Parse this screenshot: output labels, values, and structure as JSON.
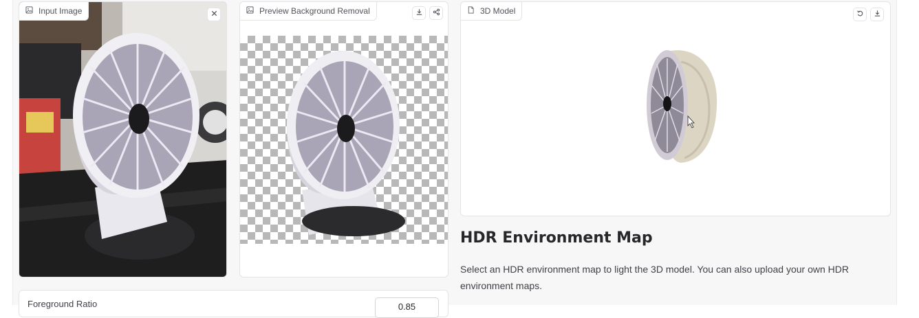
{
  "input_panel": {
    "label": "Input Image",
    "label_icon": "image-icon",
    "clear_icon": "close-icon"
  },
  "preview_panel": {
    "label": "Preview Background Removal",
    "label_icon": "image-icon",
    "actions": [
      "download-icon",
      "share-icon"
    ]
  },
  "model_panel": {
    "label": "3D Model",
    "label_icon": "file-icon",
    "actions": [
      "undo-icon",
      "download-icon"
    ]
  },
  "hdr_section": {
    "title": "HDR Environment Map",
    "description": "Select an HDR environment map to light the 3D model. You can also upload your own HDR environment maps."
  },
  "foreground_ratio": {
    "label": "Foreground Ratio",
    "value": "0.85"
  },
  "colors": {
    "background": "#f7f7f8",
    "panel_border": "#e4e4e7",
    "text": "#27272a"
  }
}
